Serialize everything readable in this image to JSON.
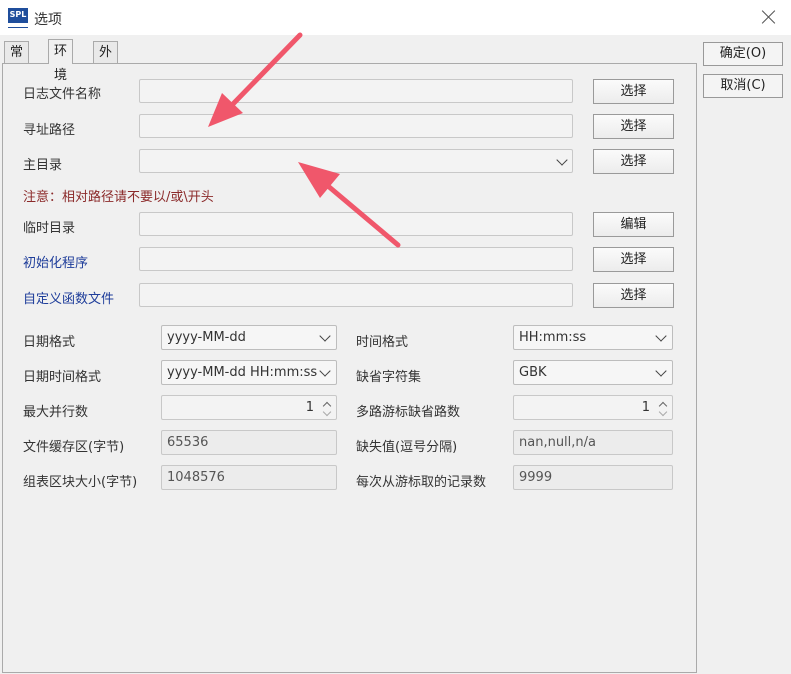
{
  "window": {
    "title": "选项",
    "app_icon_text": "SPL",
    "close_icon": "close-icon"
  },
  "tabs": [
    {
      "label": "常规",
      "active": false
    },
    {
      "label": "环境",
      "active": true
    },
    {
      "label": "外观",
      "active": false
    }
  ],
  "side_buttons": {
    "ok": "确定(O)",
    "cancel": "取消(C)"
  },
  "paths": {
    "log_file_label": "日志文件名称",
    "search_path_label": "寻址路径",
    "main_dir_label": "主目录",
    "note": "注意：相对路径请不要以/或\\开头",
    "temp_dir_label": "临时目录",
    "init_program_label": "初始化程序",
    "custom_func_label": "自定义函数文件",
    "choose": "选择",
    "edit": "编辑"
  },
  "settings": {
    "date_format": {
      "label": "日期格式",
      "value": "yyyy-MM-dd"
    },
    "time_format": {
      "label": "时间格式",
      "value": "HH:mm:ss"
    },
    "datetime_format": {
      "label": "日期时间格式",
      "value": "yyyy-MM-dd HH:mm:ss"
    },
    "charset": {
      "label": "缺省字符集",
      "value": "GBK"
    },
    "max_parallel": {
      "label": "最大并行数",
      "value": "1"
    },
    "cursor_paths": {
      "label": "多路游标缺省路数",
      "value": "1"
    },
    "file_buffer": {
      "label": "文件缓存区(字节)",
      "value": "65536"
    },
    "missing_values": {
      "label": "缺失值(逗号分隔)",
      "value": "nan,null,n/a"
    },
    "block_size": {
      "label": "组表区块大小(字节)",
      "value": "1048576"
    },
    "fetch_count": {
      "label": "每次从游标取的记录数",
      "value": "9999"
    }
  },
  "colors": {
    "annotation_arrow": "#f0576b",
    "note_text": "#8b2a2a",
    "blue_label": "#1e3d9a"
  }
}
